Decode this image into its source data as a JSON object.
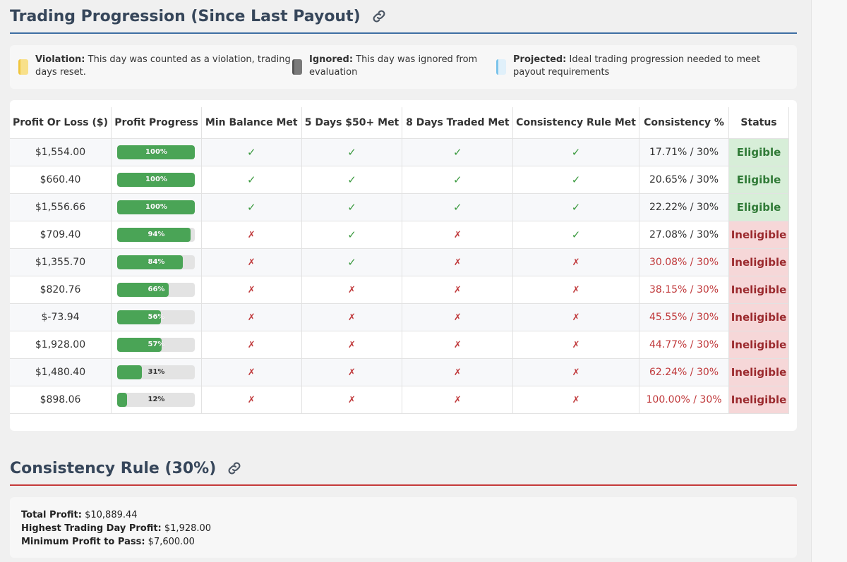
{
  "progression": {
    "title": "Trading Progression (Since Last Payout)",
    "legend": [
      {
        "label": "Violation:",
        "text": "This day was counted as a violation, trading days reset."
      },
      {
        "label": "Ignored:",
        "text": "This day was ignored from evaluation"
      },
      {
        "label": "Projected:",
        "text": "Ideal trading progression needed to meet payout requirements"
      }
    ],
    "columns": [
      "Profit Or Loss ($)",
      "Profit Progress",
      "Min Balance Met",
      "5 Days $50+ Met",
      "8 Days Traded Met",
      "Consistency Rule Met",
      "Consistency %",
      "Status"
    ],
    "rows": [
      {
        "pnl": "$1,554.00",
        "progress": 100,
        "progress_label": "100%",
        "min_balance": true,
        "five_days": true,
        "eight_days": true,
        "consistency_met": true,
        "consistency_pct": "17.71% / 30%",
        "status": "Eligible"
      },
      {
        "pnl": "$660.40",
        "progress": 100,
        "progress_label": "100%",
        "min_balance": true,
        "five_days": true,
        "eight_days": true,
        "consistency_met": true,
        "consistency_pct": "20.65% / 30%",
        "status": "Eligible"
      },
      {
        "pnl": "$1,556.66",
        "progress": 100,
        "progress_label": "100%",
        "min_balance": true,
        "five_days": true,
        "eight_days": true,
        "consistency_met": true,
        "consistency_pct": "22.22% / 30%",
        "status": "Eligible"
      },
      {
        "pnl": "$709.40",
        "progress": 94,
        "progress_label": "94%",
        "min_balance": false,
        "five_days": true,
        "eight_days": false,
        "consistency_met": true,
        "consistency_pct": "27.08% / 30%",
        "status": "Ineligible"
      },
      {
        "pnl": "$1,355.70",
        "progress": 84,
        "progress_label": "84%",
        "min_balance": false,
        "five_days": true,
        "eight_days": false,
        "consistency_met": false,
        "consistency_pct": "30.08% / 30%",
        "status": "Ineligible"
      },
      {
        "pnl": "$820.76",
        "progress": 66,
        "progress_label": "66%",
        "min_balance": false,
        "five_days": false,
        "eight_days": false,
        "consistency_met": false,
        "consistency_pct": "38.15% / 30%",
        "status": "Ineligible"
      },
      {
        "pnl": "$-73.94",
        "progress": 56,
        "progress_label": "56%",
        "min_balance": false,
        "five_days": false,
        "eight_days": false,
        "consistency_met": false,
        "consistency_pct": "45.55% / 30%",
        "status": "Ineligible"
      },
      {
        "pnl": "$1,928.00",
        "progress": 57,
        "progress_label": "57%",
        "min_balance": false,
        "five_days": false,
        "eight_days": false,
        "consistency_met": false,
        "consistency_pct": "44.77% / 30%",
        "status": "Ineligible"
      },
      {
        "pnl": "$1,480.40",
        "progress": 31,
        "progress_label": "31%",
        "min_balance": false,
        "five_days": false,
        "eight_days": false,
        "consistency_met": false,
        "consistency_pct": "62.24% / 30%",
        "status": "Ineligible"
      },
      {
        "pnl": "$898.06",
        "progress": 12,
        "progress_label": "12%",
        "min_balance": false,
        "five_days": false,
        "eight_days": false,
        "consistency_met": false,
        "consistency_pct": "100.00% / 30%",
        "status": "Ineligible"
      }
    ],
    "check_glyph": "✓",
    "cross_glyph": "✗"
  },
  "consistency": {
    "title": "Consistency Rule (30%)",
    "total_profit_label": "Total Profit:",
    "total_profit_value": "$10,889.44",
    "highest_day_label": "Highest Trading Day Profit:",
    "highest_day_value": "$1,928.00",
    "minimum_label": "Minimum Profit to Pass:",
    "minimum_value": "$7,600.00"
  },
  "colors": {
    "eligible_bg": "#d7eed8",
    "ineligible_bg": "#f6d7d8",
    "progress_fill": "#4aa456",
    "heading_rule_blue": "#3d6ea3",
    "heading_rule_red": "#c53a3a"
  },
  "icons": {
    "heading_link": "link-icon"
  }
}
